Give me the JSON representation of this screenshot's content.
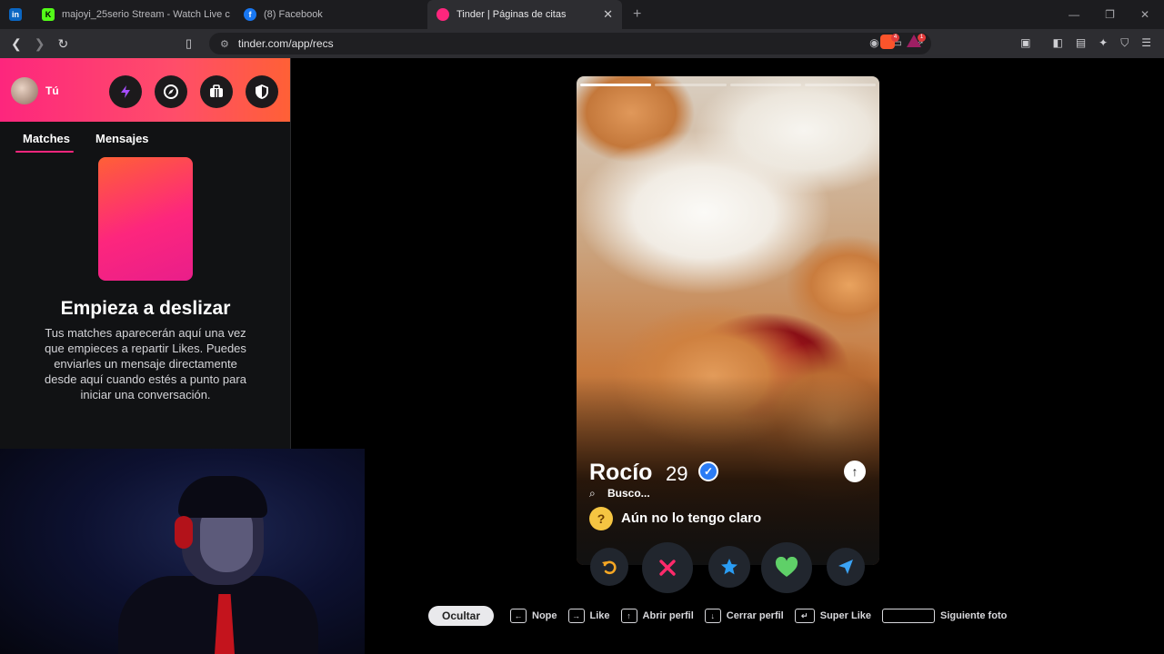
{
  "browser": {
    "tabs": [
      {
        "label": "",
        "favicon": "linkedin-icon",
        "color": "#0a66c2"
      },
      {
        "label": "majoyi_25serio Stream - Watch Live c",
        "favicon": "kick-icon",
        "color": "#53fc18"
      },
      {
        "label": "(8) Facebook",
        "favicon": "facebook-icon",
        "color": "#1877f2"
      },
      {
        "label": "Tinder | Páginas de citas",
        "favicon": "tinder-icon",
        "color": "#fd267d"
      }
    ],
    "new_tab": "+",
    "url": "tinder.com/app/recs",
    "brave_badge": "4",
    "rewards_badge": "1"
  },
  "sidebar": {
    "user_label": "Tú",
    "tabs": [
      "Matches",
      "Mensajes"
    ],
    "empty_title": "Empieza a deslizar",
    "empty_desc": "Tus matches aparecerán aquí una vez que empieces a repartir Likes. Puedes enviarles un mensaje directamente desde aquí cuando estés a punto para iniciar una conversación."
  },
  "profile": {
    "name": "Rocío",
    "age": "29",
    "looking_label": "Busco...",
    "looking_value": "Aún no lo tengo claro",
    "photo_count": 4,
    "current_photo": 1
  },
  "colors": {
    "brand": "#fd267d",
    "brand_orange": "#ff6036",
    "rewind": "#f5a623",
    "nope": "#ff2a6b",
    "super_like": "#2a9df4",
    "like": "#5fd068",
    "boost": "#3ba3f5"
  },
  "shortcuts": {
    "hide": "Ocultar",
    "items": [
      {
        "key": "←",
        "label": "Nope"
      },
      {
        "key": "→",
        "label": "Like"
      },
      {
        "key": "↑",
        "label": "Abrir perfil"
      },
      {
        "key": "↓",
        "label": "Cerrar perfil"
      },
      {
        "key": "↵",
        "label": "Super Like"
      },
      {
        "key": "",
        "label": "Siguiente foto"
      }
    ]
  }
}
